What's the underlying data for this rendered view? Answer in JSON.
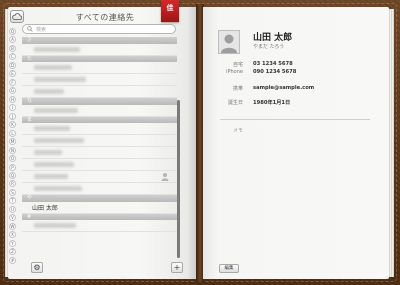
{
  "left_page": {
    "title": "すべての連絡先",
    "ribbon_label": "佳",
    "search_placeholder": "検索",
    "index_letters": [
      "Q",
      "A",
      "B",
      "C",
      "D",
      "E",
      "F",
      "G",
      "H",
      "I",
      "J",
      "K",
      "L",
      "M",
      "N",
      "O",
      "P",
      "Q",
      "R",
      "S",
      "T",
      "U",
      "V",
      "W",
      "X",
      "Y",
      "Z",
      "#"
    ],
    "sections": [
      {
        "header": "さ",
        "rows": [
          "blur"
        ]
      },
      {
        "header": "た",
        "rows": [
          "blur",
          "blur",
          "blur"
        ]
      },
      {
        "header": "な",
        "rows": [
          "blur"
        ]
      },
      {
        "header": "ま",
        "rows": [
          "blur",
          "blur",
          "blur",
          "blur",
          "blur",
          "blur"
        ]
      },
      {
        "header": "や",
        "rows": [
          "山田 太郎"
        ]
      },
      {
        "header": "#",
        "rows": [
          "blur"
        ]
      }
    ],
    "selected_contact": "山田 太郎"
  },
  "right_page": {
    "name": "山田 太郎",
    "furigana": "やまだ たろう",
    "fields": [
      {
        "label": "自宅",
        "value": "03 1234 5678"
      },
      {
        "label": "iPhone",
        "value": "090 1234 5678"
      },
      {
        "label": "携帯",
        "value": "sample@sample.com"
      },
      {
        "label": "誕生日",
        "value": "1980年1月1日"
      }
    ],
    "memo_label": "メモ",
    "edit_label": "編集"
  },
  "colors": {
    "leather": "#5a3619",
    "ribbon": "#c42020",
    "page": "#f6f6f4"
  }
}
